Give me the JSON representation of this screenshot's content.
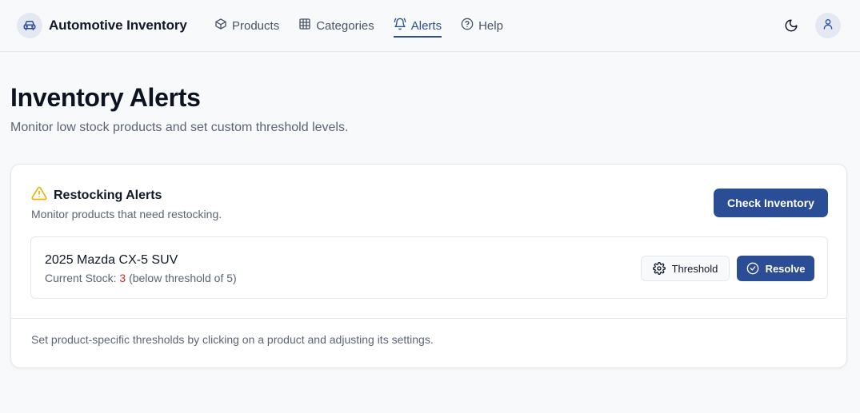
{
  "header": {
    "brand_title": "Automotive Inventory",
    "nav": [
      {
        "label": "Products",
        "icon": "box-icon"
      },
      {
        "label": "Categories",
        "icon": "grid-icon"
      },
      {
        "label": "Alerts",
        "icon": "bell-icon",
        "active": true
      },
      {
        "label": "Help",
        "icon": "help-circle-icon"
      }
    ]
  },
  "page": {
    "title": "Inventory Alerts",
    "subtitle": "Monitor low stock products and set custom threshold levels."
  },
  "card": {
    "title": "Restocking Alerts",
    "description": "Monitor products that need restocking.",
    "check_button": "Check Inventory",
    "alerts": [
      {
        "product": "2025 Mazda CX-5 SUV",
        "stock_prefix": "Current Stock:",
        "stock_value": "3",
        "stock_suffix": "(below threshold of 5)",
        "threshold_button": "Threshold",
        "resolve_button": "Resolve"
      }
    ],
    "footer": "Set product-specific thresholds by clicking on a product and adjusting its settings."
  },
  "colors": {
    "accent": "#2a4d96",
    "danger": "#dc2626",
    "warning": "#eab308"
  }
}
